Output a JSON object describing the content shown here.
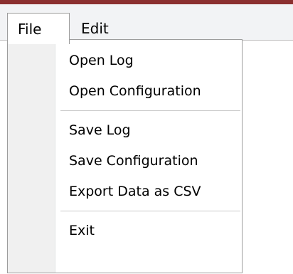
{
  "menubar": {
    "file_label": "File",
    "edit_label": "Edit"
  },
  "file_menu": {
    "items": [
      {
        "label": "Open Log"
      },
      {
        "label": "Open Configuration"
      },
      {
        "label": "Save Log"
      },
      {
        "label": "Save Configuration"
      },
      {
        "label": "Export Data as CSV"
      },
      {
        "label": "Exit"
      }
    ]
  }
}
